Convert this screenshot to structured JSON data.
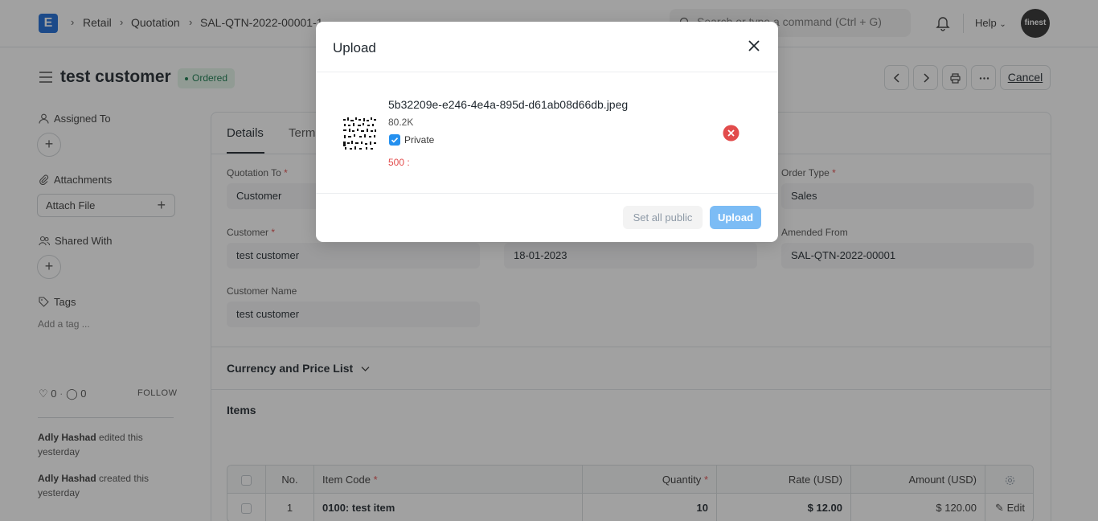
{
  "navbar": {
    "logo_letter": "E",
    "breadcrumbs": [
      "Retail",
      "Quotation",
      "SAL-QTN-2022-00001-1"
    ],
    "search_placeholder": "Search or type a command (Ctrl + G)",
    "help_label": "Help",
    "avatar_text": "finest"
  },
  "header": {
    "title": "test customer",
    "status": "Ordered",
    "cancel_label": "Cancel"
  },
  "sidebar": {
    "assigned_to": "Assigned To",
    "attachments": "Attachments",
    "attach_file": "Attach File",
    "shared_with": "Shared With",
    "tags": "Tags",
    "add_tag": "Add a tag ...",
    "likes": "0",
    "comments": "0",
    "follow": "FOLLOW",
    "activity": [
      {
        "user": "Adly Hashad",
        "action": " edited this",
        "when": "yesterday"
      },
      {
        "user": "Adly Hashad",
        "action": " created this",
        "when": "yesterday"
      }
    ]
  },
  "form": {
    "tabs": [
      "Details",
      "Terms"
    ],
    "quotation_to_label": "Quotation To",
    "quotation_to_value": "Customer",
    "order_type_label": "Order Type",
    "order_type_value": "Sales",
    "customer_label": "Customer",
    "customer_value": "test customer",
    "date_value": "18-01-2023",
    "amended_from_label": "Amended From",
    "amended_from_value": "SAL-QTN-2022-00001",
    "customer_name_label": "Customer Name",
    "customer_name_value": "test customer",
    "currency_section": "Currency and Price List",
    "items_section": "Items",
    "required_mark": "*"
  },
  "items_table": {
    "headers": [
      "No.",
      "Item Code",
      "Quantity",
      "Rate (USD)",
      "Amount (USD)"
    ],
    "rows": [
      {
        "no": "1",
        "item_code": "0100: test item",
        "qty": "10",
        "rate": "$ 12.00",
        "amount": "$ 120.00",
        "edit": "Edit"
      }
    ]
  },
  "upload_dialog": {
    "title": "Upload",
    "file_name": "5b32209e-e246-4e4a-895d-d61ab08d66db.jpeg",
    "file_size": "80.2K",
    "private_label": "Private",
    "error": "500 :",
    "set_all_public": "Set all public",
    "upload": "Upload"
  },
  "colors": {
    "accent": "#2490ef",
    "upload_button": "#7cbcf5",
    "error": "#e24c4c",
    "status_green": "#16794c",
    "logo_blue": "#1b6ad6"
  }
}
